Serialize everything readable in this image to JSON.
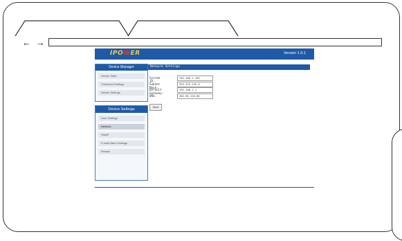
{
  "browser": {
    "back_glyph": "←",
    "forward_glyph": "→",
    "address_value": ""
  },
  "header": {
    "logo_left": "IPO",
    "logo_x": "W",
    "logo_right": "ER",
    "version": "Version 1.0.1",
    "bar_color": "#1e5aa8"
  },
  "sidebar": {
    "device_manager": {
      "title": "Device Manager",
      "items": [
        {
          "label": "Device State"
        },
        {
          "label": "Threshold Settings"
        },
        {
          "label": "Device Settings"
        }
      ]
    },
    "device_settings": {
      "title": "Device Settings",
      "items": [
        {
          "label": "User Settings"
        },
        {
          "label": "Network"
        },
        {
          "label": "SNMP"
        },
        {
          "label": "E-mail Alarm Settings"
        },
        {
          "label": "Restart"
        }
      ],
      "active_item": "Network"
    }
  },
  "content": {
    "title": "Network Settings",
    "fields": [
      {
        "label": "System IP:",
        "value": "192.168.1.163"
      },
      {
        "label": "Subnet Mask:",
        "value": "255.255.255.0"
      },
      {
        "label": "Default Gateway:",
        "value": "192.168.1.1"
      },
      {
        "label": "DNS:",
        "value": "202.96.128.86"
      }
    ],
    "save_label": "Save"
  }
}
